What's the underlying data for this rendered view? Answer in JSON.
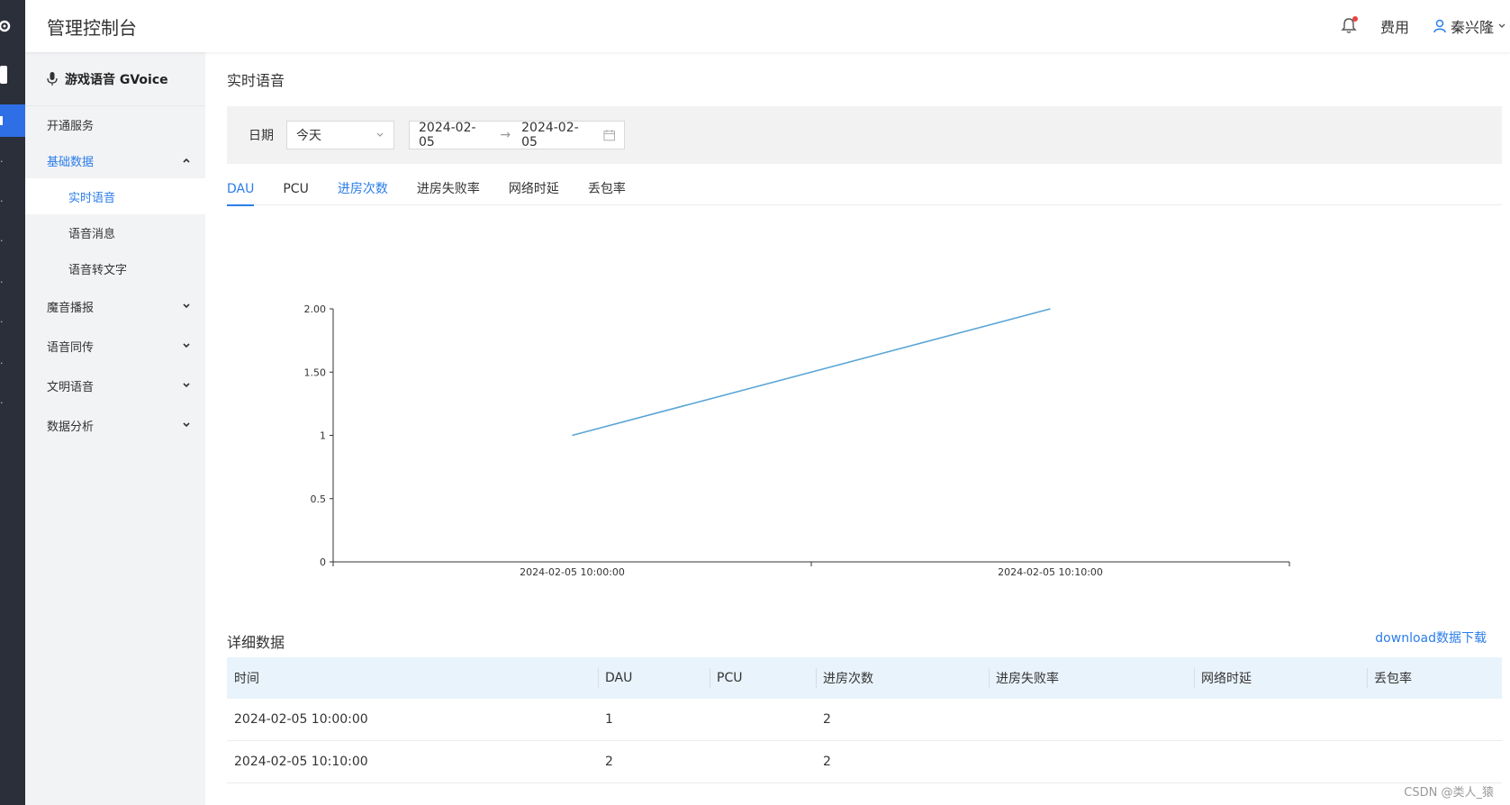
{
  "app": {
    "title": "管理控制台"
  },
  "header": {
    "cost_label": "费用",
    "user_name": "秦兴隆"
  },
  "sidebar": {
    "product": "游戏语音 GVoice",
    "items": [
      {
        "label": "开通服务"
      },
      {
        "label": "基础数据",
        "expanded": true
      },
      {
        "label": "魔音播报"
      },
      {
        "label": "语音同传"
      },
      {
        "label": "文明语音"
      },
      {
        "label": "数据分析"
      }
    ],
    "subitems": [
      {
        "label": "实时语音",
        "active": true
      },
      {
        "label": "语音消息"
      },
      {
        "label": "语音转文字"
      }
    ]
  },
  "page": {
    "title": "实时语音"
  },
  "filter": {
    "date_label": "日期",
    "preset": "今天",
    "start": "2024-02-05",
    "arrow": "→",
    "end": "2024-02-05"
  },
  "tabs": [
    {
      "label": "DAU",
      "active": true
    },
    {
      "label": "PCU"
    },
    {
      "label": "进房次数"
    },
    {
      "label": "进房失败率"
    },
    {
      "label": "网络时延"
    },
    {
      "label": "丢包率"
    }
  ],
  "chart_data": {
    "type": "line",
    "x": [
      "2024-02-05 10:00:00",
      "2024-02-05 10:10:00"
    ],
    "series": [
      {
        "values": [
          1,
          2
        ],
        "color": "#5aa5d6"
      }
    ],
    "y_ticks": [
      "0",
      "0.5",
      "1",
      "1.50",
      "2.00"
    ],
    "ylim": [
      0,
      2
    ],
    "grid": false
  },
  "detail": {
    "title": "详细数据",
    "download": "download数据下载",
    "columns": [
      "时间",
      "DAU",
      "PCU",
      "进房次数",
      "进房失败率",
      "网络时延",
      "丢包率"
    ],
    "rows": [
      [
        "2024-02-05 10:00:00",
        "1",
        "",
        "2",
        "",
        "",
        ""
      ],
      [
        "2024-02-05 10:10:00",
        "2",
        "",
        "2",
        "",
        "",
        ""
      ]
    ]
  },
  "watermark": "CSDN @类人_猿"
}
